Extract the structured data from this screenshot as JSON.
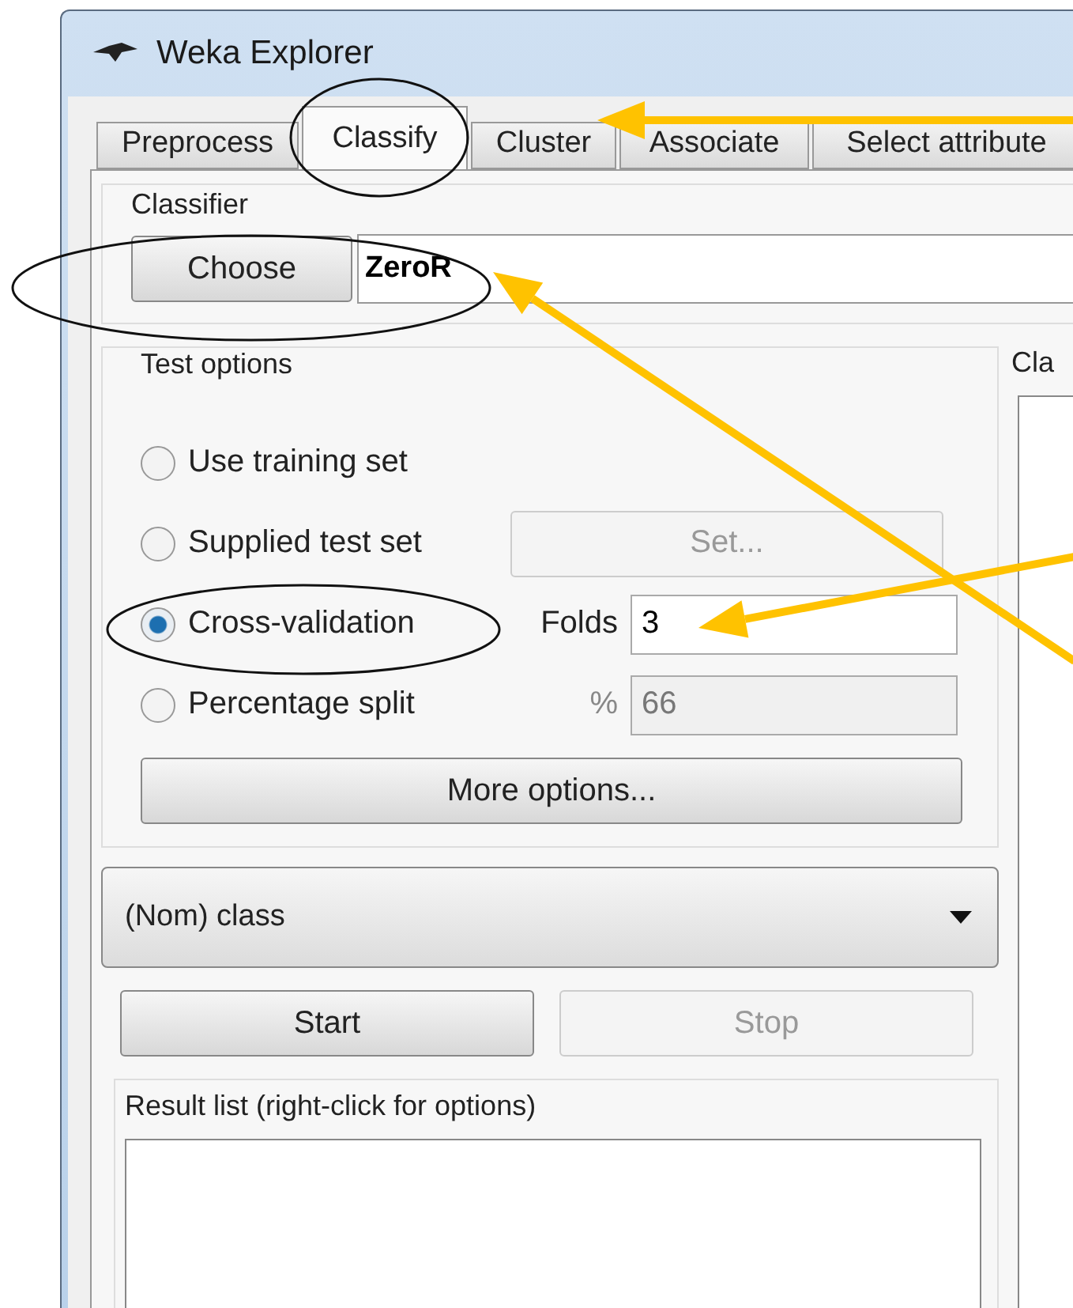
{
  "window": {
    "title": "Weka Explorer"
  },
  "tabs": [
    {
      "label": "Preprocess",
      "selected": false
    },
    {
      "label": "Classify",
      "selected": true
    },
    {
      "label": "Cluster",
      "selected": false
    },
    {
      "label": "Associate",
      "selected": false
    },
    {
      "label": "Select attribute",
      "selected": false
    }
  ],
  "classifier": {
    "title": "Classifier",
    "choose_button": "Choose",
    "value": "ZeroR"
  },
  "test_options": {
    "title": "Test options",
    "options": [
      {
        "label": "Use training set",
        "selected": false
      },
      {
        "label": "Supplied test set",
        "selected": false,
        "button": {
          "label": "Set...",
          "disabled": true
        }
      },
      {
        "label": "Cross-validation",
        "selected": true,
        "field": {
          "label": "Folds",
          "value": "3",
          "disabled": false
        }
      },
      {
        "label": "Percentage split",
        "selected": false,
        "field": {
          "label": "%",
          "value": "66",
          "disabled": true
        }
      }
    ],
    "more_button": "More options..."
  },
  "class_select": {
    "value": "(Nom) class"
  },
  "run_buttons": [
    {
      "label": "Start",
      "disabled": false
    },
    {
      "label": "Stop",
      "disabled": true
    }
  ],
  "result_list": {
    "title": "Result list (right-click for options)"
  },
  "output": {
    "title": "Cla"
  }
}
